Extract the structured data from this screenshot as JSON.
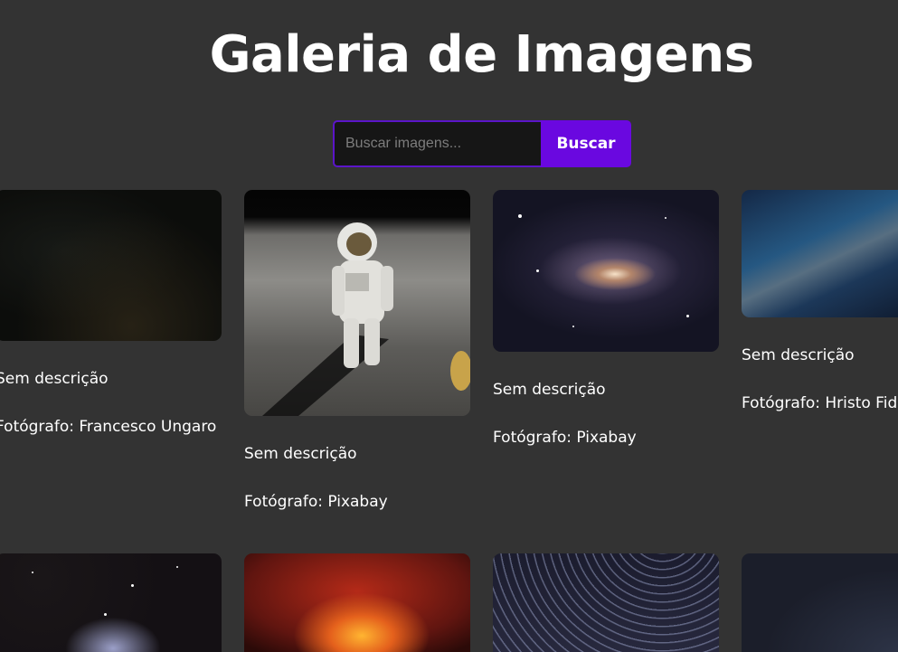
{
  "page": {
    "title": "Galeria de Imagens"
  },
  "search": {
    "placeholder": "Buscar imagens...",
    "value": "",
    "button_label": "Buscar"
  },
  "gallery": {
    "cards": [
      {
        "image_alt": "Céu estrelado escuro",
        "description": "Sem descrição",
        "photographer": "Fotógrafo: Francesco Ungaro"
      },
      {
        "image_alt": "Astronauta na Lua",
        "description": "Sem descrição",
        "photographer": "Fotógrafo: Pixabay"
      },
      {
        "image_alt": "Galáxia espiral",
        "description": "Sem descrição",
        "photographer": "Fotógrafo: Pixabay"
      },
      {
        "image_alt": "Via Láctea",
        "description": "Sem descrição",
        "photographer": "Fotógrafo: Hristo Fidanov"
      },
      {
        "image_alt": "Nebulosa com estrelas"
      },
      {
        "image_alt": "Nebulosa vermelha"
      },
      {
        "image_alt": "Rastro de estrelas"
      },
      {
        "image_alt": "Céu noturno"
      }
    ]
  },
  "colors": {
    "background": "#333333",
    "accent": "#6a08e0",
    "input_border": "#5b15c9"
  }
}
